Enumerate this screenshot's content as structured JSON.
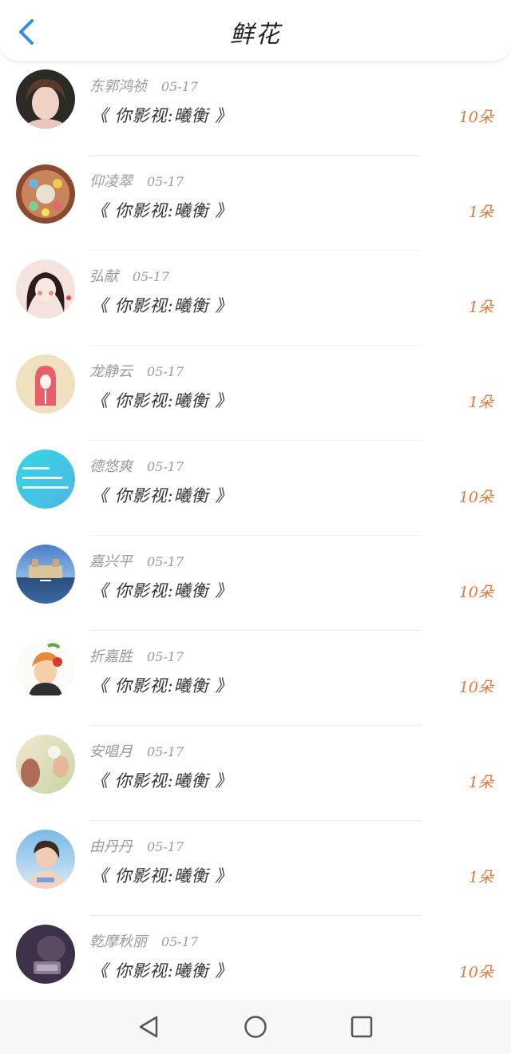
{
  "header": {
    "title": "鲜花",
    "back_icon": "chevron-left-icon",
    "accent_color": "#2f8fe0"
  },
  "items": [
    {
      "name": "东郭鸿祯",
      "date": "05-17",
      "work": "《 你影视:曦衡 》",
      "amount": "10朵"
    },
    {
      "name": "仰凌翠",
      "date": "05-17",
      "work": "《 你影视:曦衡 》",
      "amount": "1朵"
    },
    {
      "name": "弘献",
      "date": "05-17",
      "work": "《 你影视:曦衡 》",
      "amount": "1朵"
    },
    {
      "name": "龙静云",
      "date": "05-17",
      "work": "《 你影视:曦衡 》",
      "amount": "1朵"
    },
    {
      "name": "德悠爽",
      "date": "05-17",
      "work": "《 你影视:曦衡 》",
      "amount": "10朵"
    },
    {
      "name": "嘉兴平",
      "date": "05-17",
      "work": "《 你影视:曦衡 》",
      "amount": "10朵"
    },
    {
      "name": "折嘉胜",
      "date": "05-17",
      "work": "《 你影视:曦衡 》",
      "amount": "10朵"
    },
    {
      "name": "安唱月",
      "date": "05-17",
      "work": "《 你影视:曦衡 》",
      "amount": "1朵"
    },
    {
      "name": "由丹丹",
      "date": "05-17",
      "work": "《 你影视:曦衡 》",
      "amount": "1朵"
    },
    {
      "name": "乾摩秋丽",
      "date": "05-17",
      "work": "《 你影视:曦衡 》",
      "amount": "10朵"
    }
  ],
  "avatars": [
    {
      "icon": "avatar-photo-woman"
    },
    {
      "icon": "avatar-cartoon-collage"
    },
    {
      "icon": "avatar-illustrated-girl"
    },
    {
      "icon": "avatar-cartoon-figure"
    },
    {
      "icon": "avatar-text-banner"
    },
    {
      "icon": "avatar-castle-landscape"
    },
    {
      "icon": "avatar-illustrated-person"
    },
    {
      "icon": "avatar-photo-outdoor"
    },
    {
      "icon": "avatar-photo-portrait"
    },
    {
      "icon": "avatar-photo-dark"
    }
  ],
  "amount_color": "#e0793e",
  "navbar": {
    "back_icon": "triangle-back-icon",
    "home_icon": "circle-home-icon",
    "recents_icon": "square-recents-icon"
  }
}
